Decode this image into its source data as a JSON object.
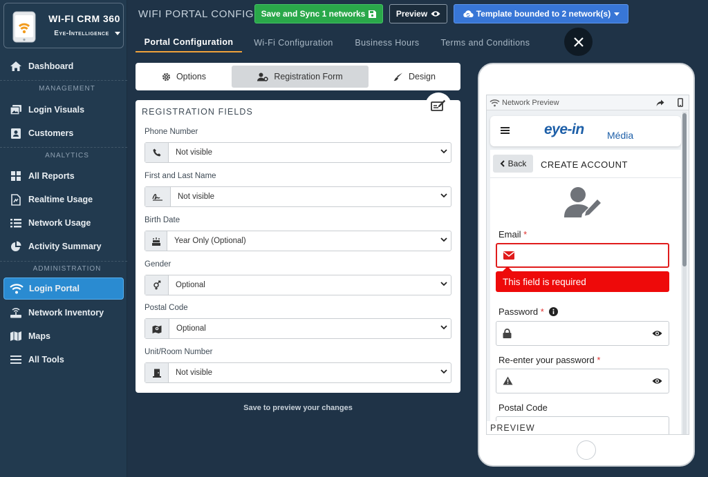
{
  "brand": {
    "title": "WI-FI CRM 360",
    "subtitle": "Eye-Intelligence"
  },
  "sidebar": {
    "items": [
      {
        "label": "Dashboard",
        "icon": "home-icon"
      },
      {
        "label": "Login Visuals",
        "icon": "images-icon"
      },
      {
        "label": "Customers",
        "icon": "contact-card-icon"
      },
      {
        "label": "All Reports",
        "icon": "reports-grid-icon"
      },
      {
        "label": "Realtime Usage",
        "icon": "realtime-file-icon"
      },
      {
        "label": "Network Usage",
        "icon": "list-icon"
      },
      {
        "label": "Activity Summary",
        "icon": "pie-chart-icon"
      },
      {
        "label": "Login Portal",
        "icon": "wifi-icon",
        "active": true
      },
      {
        "label": "Network Inventory",
        "icon": "router-icon"
      },
      {
        "label": "Maps",
        "icon": "map-icon"
      },
      {
        "label": "All Tools",
        "icon": "menu-icon"
      }
    ],
    "sections": {
      "management": "MANAGEMENT",
      "analytics": "ANALYTICS",
      "administration": "ADMINISTRATION"
    }
  },
  "header": {
    "title": "WIFI PORTAL CONFIG",
    "save_button": "Save and Sync 1 networks",
    "preview_button": "Preview",
    "template_button": "Template bounded to 2 network(s)",
    "tabs": [
      {
        "label": "Portal Configuration",
        "active": true
      },
      {
        "label": "Wi-Fi Configuration"
      },
      {
        "label": "Business Hours"
      },
      {
        "label": "Terms and Conditions"
      }
    ]
  },
  "subtabs": [
    {
      "label": "Options",
      "icon": "gear-icon"
    },
    {
      "label": "Registration Form",
      "icon": "user-gear-icon",
      "active": true
    },
    {
      "label": "Design",
      "icon": "brush-icon"
    }
  ],
  "registration": {
    "title": "REGISTRATION FIELDS",
    "fields": [
      {
        "label": "Phone Number",
        "value": "Not visible",
        "icon": "phone-icon"
      },
      {
        "label": "First and Last Name",
        "value": "Not visible",
        "icon": "signature-icon"
      },
      {
        "label": "Birth Date",
        "value": "Year Only (Optional)",
        "icon": "cake-icon"
      },
      {
        "label": "Gender",
        "value": "Optional",
        "icon": "gender-icon"
      },
      {
        "label": "Postal Code",
        "value": "Optional",
        "icon": "map-location-icon"
      },
      {
        "label": "Unit/Room Number",
        "value": "Not visible",
        "icon": "door-icon"
      }
    ]
  },
  "save_hint": "Save to preview your changes",
  "preview": {
    "header_label": "Network Preview",
    "logo_main": "eye-in",
    "logo_suffix": "Média",
    "back_label": "Back",
    "form_title": "CREATE ACCOUNT",
    "email_label": "Email",
    "error_message": "This field is required",
    "password_label": "Password",
    "reenter_label": "Re-enter your password",
    "postal_label": "Postal Code",
    "required_mark": "*",
    "tag": "PREVIEW"
  },
  "colors": {
    "sidebar_bg": "#223a4f",
    "main_bg": "#1f3347",
    "active_blue": "#2a8bd1",
    "save_green": "#2aa84a",
    "template_blue": "#3876d6",
    "tab_underline": "#f0a23a",
    "error_red": "#ee0a0a"
  }
}
